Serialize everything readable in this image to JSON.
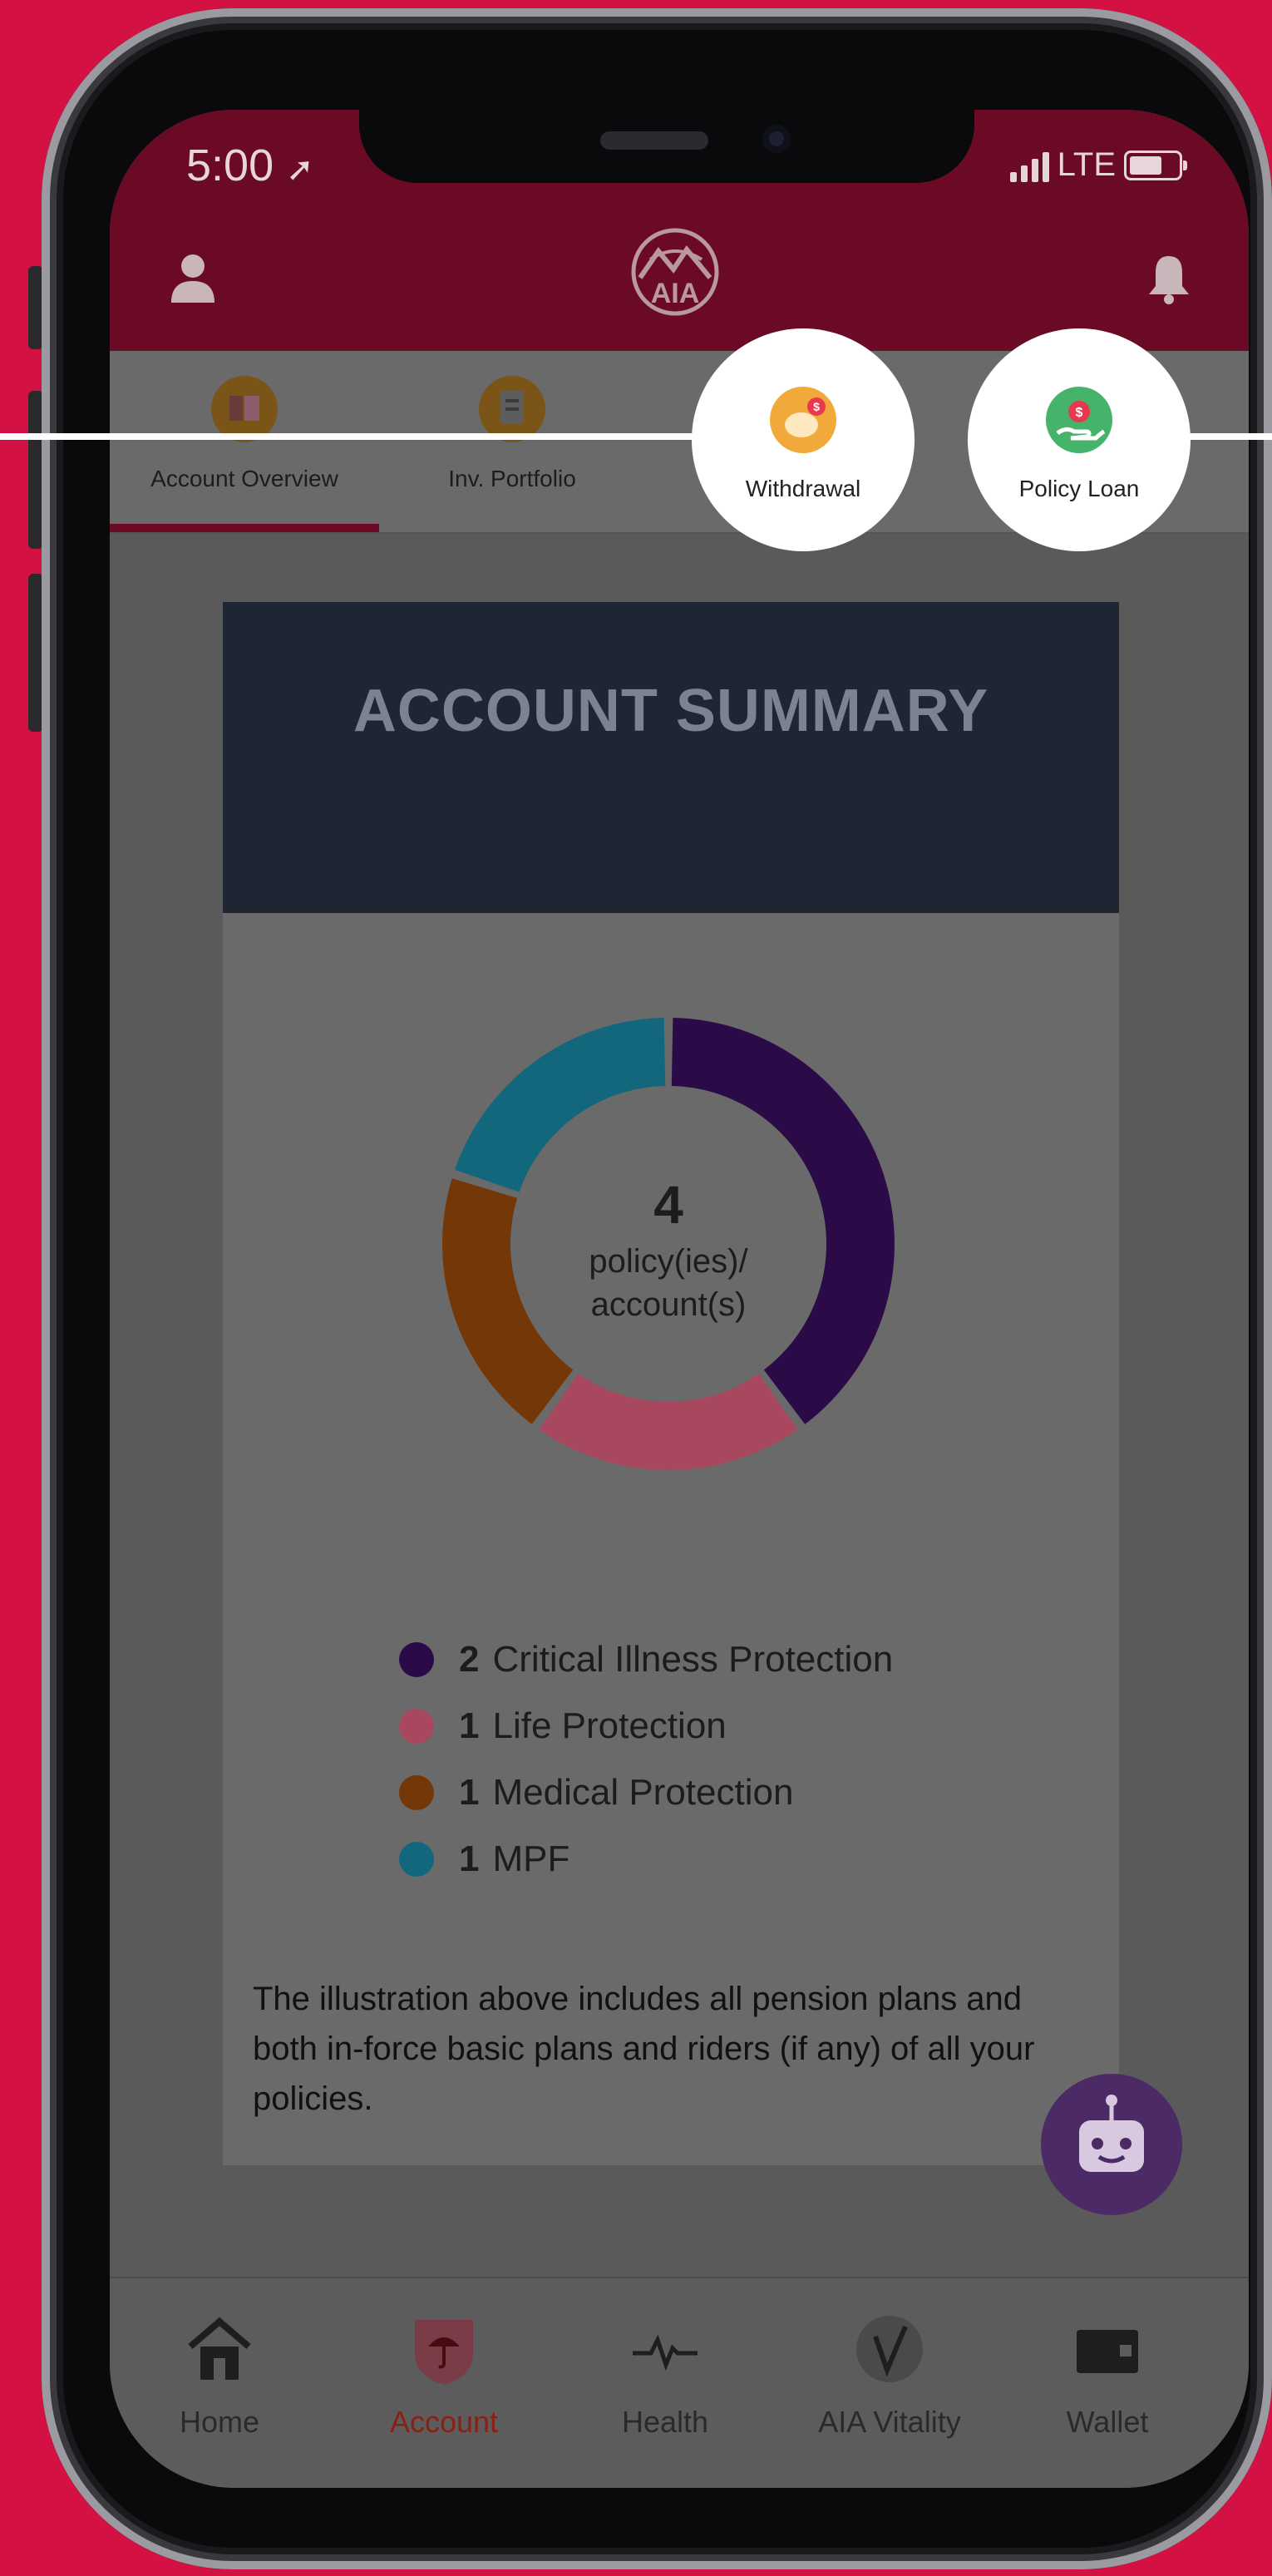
{
  "status": {
    "time": "5:00",
    "network": "LTE"
  },
  "tabs": [
    {
      "label": "Account Overview",
      "icon": "account-overview-icon"
    },
    {
      "label": "Inv. Portfolio",
      "icon": "portfolio-icon"
    },
    {
      "label": "Withdrawal",
      "icon": "piggy-bank-icon"
    },
    {
      "label": "Policy Loan",
      "icon": "loan-hand-icon"
    }
  ],
  "card": {
    "title": "ACCOUNT SUMMARY",
    "total": "4",
    "total_label_1": "policy(ies)/",
    "total_label_2": "account(s)",
    "legend": [
      {
        "count": "2",
        "label": "Critical Illness Protection",
        "color": "#2a0b48"
      },
      {
        "count": "1",
        "label": "Life Protection",
        "color": "#a8485e"
      },
      {
        "count": "1",
        "label": "Medical Protection",
        "color": "#743707"
      },
      {
        "count": "1",
        "label": "MPF",
        "color": "#13677d"
      }
    ],
    "note": "The illustration above includes all pension plans and both in-force basic plans and riders (if any) of all your policies."
  },
  "chart_data": {
    "type": "pie",
    "categories": [
      "Critical Illness Protection",
      "Life Protection",
      "Medical Protection",
      "MPF"
    ],
    "values": [
      2,
      1,
      1,
      1
    ]
  },
  "bottom_nav": [
    {
      "label": "Home",
      "icon": "home-icon"
    },
    {
      "label": "Account",
      "icon": "umbrella-shield-icon"
    },
    {
      "label": "Health",
      "icon": "heartbeat-icon"
    },
    {
      "label": "AIA Vitality",
      "icon": "vitality-icon"
    },
    {
      "label": "Wallet",
      "icon": "wallet-icon"
    }
  ]
}
